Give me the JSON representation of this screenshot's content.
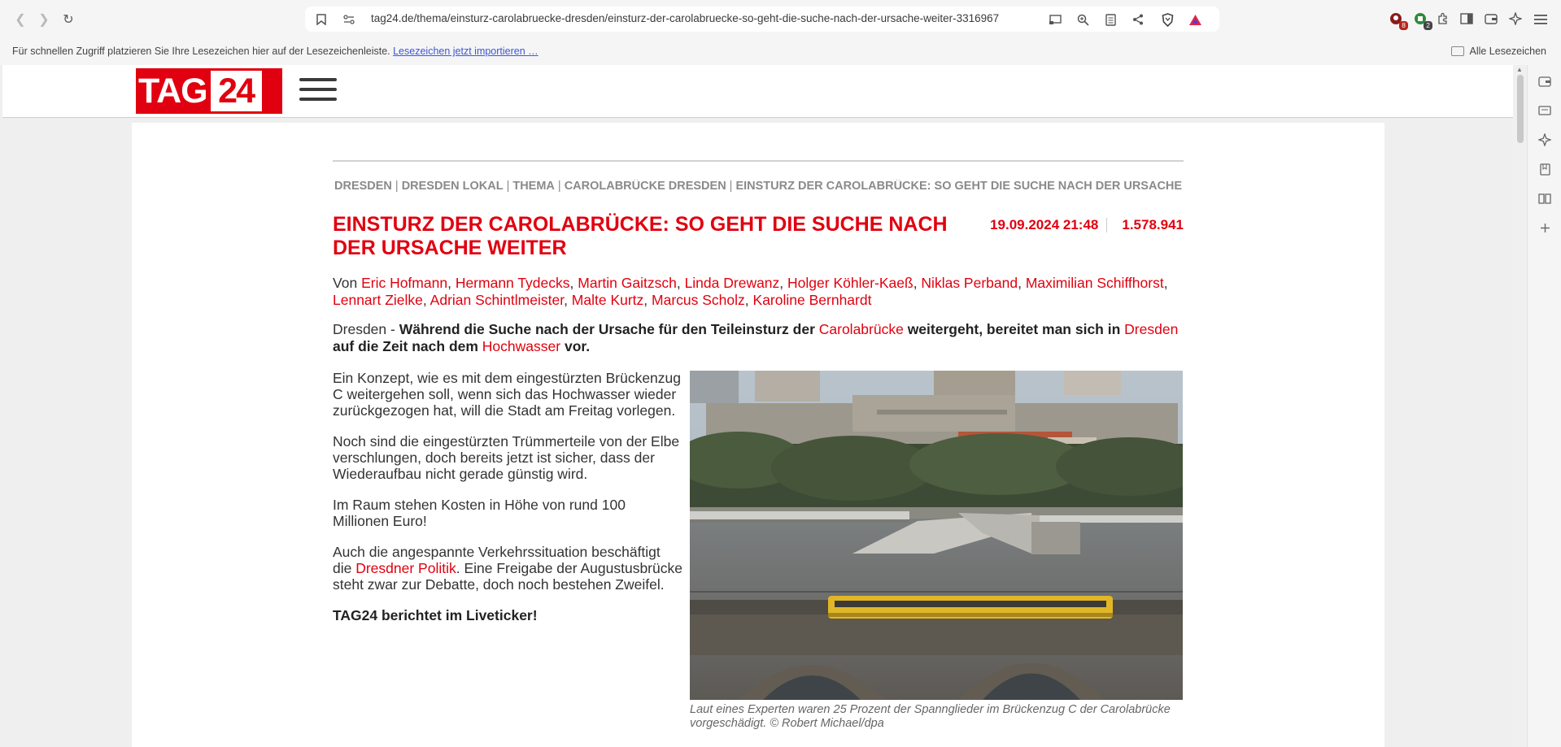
{
  "browser": {
    "url": "tag24.de/thema/einsturz-carolabruecke-dresden/einsturz-der-carolabruecke-so-geht-die-suche-nach-der-ursache-weiter-3316967",
    "extension_badges": [
      "8",
      "2"
    ],
    "bookmarks_bar": {
      "text": "Für schnellen Zugriff platzieren Sie Ihre Lesezeichen hier auf der Lesezeichenleiste.",
      "link": "Lesezeichen jetzt importieren …",
      "all_bookmarks": "Alle Lesezeichen"
    }
  },
  "site": {
    "logo_tag": "TAG",
    "logo_num": "24"
  },
  "breadcrumb": [
    "DRESDEN",
    "DRESDEN LOKAL",
    "THEMA",
    "CAROLABRÜCKE DRESDEN",
    "EINSTURZ DER CAROLABRÜCKE: SO GEHT DIE SUCHE NACH DER URSACHE WEITER"
  ],
  "article": {
    "headline": "EINSTURZ DER CAROLABRÜCKE: SO GEHT DIE SUCHE NACH DER URSACHE WEITER",
    "date": "19.09.2024 21:48",
    "views": "1.578.941",
    "byline_prefix": "Von",
    "authors": [
      "Eric Hofmann",
      "Hermann Tydecks",
      "Martin Gaitzsch",
      "Linda Drewanz",
      "Holger Köhler-Kaeß",
      "Niklas Perband",
      "Maximilian Schiffhorst",
      "Lennart Zielke",
      "Adrian Schintlmeister",
      "Malte Kurtz",
      "Marcus Scholz",
      "Karoline Bernhardt"
    ],
    "lead": {
      "location": "Dresden - ",
      "t1": "Während die Suche nach der Ursache für den Teileinsturz der ",
      "l1": "Carolabrücke",
      "t2": " weitergeht, bereitet man sich in ",
      "l2": "Dresden",
      "t3": " auf die Zeit nach dem ",
      "l3": "Hochwasser",
      "t4": " vor."
    },
    "paragraphs": {
      "p1": "Ein Konzept, wie es mit dem eingestürzten Brückenzug C weitergehen soll, wenn sich das Hochwasser wieder zurückgezogen hat, will die Stadt am Freitag vorlegen.",
      "p2": "Noch sind die eingestürzten Trümmerteile von der Elbe verschlungen, doch bereits jetzt ist sicher, dass der Wiederaufbau nicht gerade günstig wird.",
      "p3": "Im Raum stehen Kosten in Höhe von rund 100 Millionen Euro!",
      "p4_a": "Auch die angespannte Verkehrssituation beschäftigt die ",
      "p4_link": "Dresdner Politik",
      "p4_b": ". Eine Freigabe der Augustusbrücke steht zwar zur Debatte, doch noch bestehen Zweifel.",
      "p5": "TAG24 berichtet im Liveticker!"
    },
    "caption": "Laut eines Experten waren 25 Prozent der Spannglieder im Brückenzug C der Carolabrücke vorgeschädigt.  © Robert Michael/dpa"
  }
}
